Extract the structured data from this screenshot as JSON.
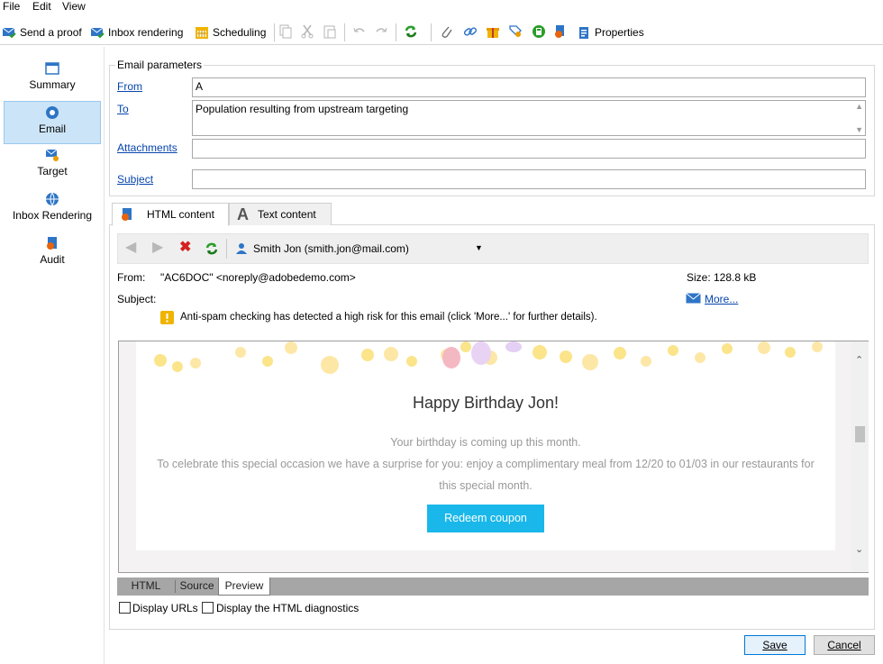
{
  "menu": {
    "items": [
      "File",
      "Edit",
      "View"
    ]
  },
  "toolbar": {
    "send_proof": "Send a proof",
    "inbox_rendering": "Inbox rendering",
    "scheduling": "Scheduling",
    "properties": "Properties"
  },
  "nav": {
    "items": [
      {
        "label": "Summary",
        "icon": "summary-icon"
      },
      {
        "label": "Email",
        "icon": "email-icon"
      },
      {
        "label": "Target",
        "icon": "target-icon"
      },
      {
        "label": "Inbox Rendering",
        "icon": "globe-icon"
      },
      {
        "label": "Audit",
        "icon": "audit-icon"
      }
    ],
    "active": "Email"
  },
  "params": {
    "legend": "Email parameters",
    "from_label": "From",
    "from_value": "A",
    "to_label": "To",
    "to_value": "Population resulting from upstream targeting",
    "attachments_label": "Attachments",
    "attachments_value": "",
    "subject_label": "Subject",
    "subject_value": ""
  },
  "content_tabs": {
    "html": "HTML content",
    "text": "Text content"
  },
  "preview": {
    "recipient": "Smith Jon (smith.jon@mail.com)",
    "from_label": "From:",
    "from_value": "\"AC6DOC\" <noreply@adobedemo.com>",
    "subject_label": "Subject:",
    "size_label": "Size:",
    "size_value": "128.8 kB",
    "more_link": "More...",
    "warning": "Anti-spam checking has detected a high risk for this email (click 'More...' for further details)."
  },
  "email": {
    "heading": "Happy Birthday Jon!",
    "line1": "Your birthday is coming up this month.",
    "line2": "To celebrate this special occasion we have a surprise for you: enjoy a complimentary meal from 12/20 to 01/03 in our restaurants for",
    "line3": "this special month.",
    "button": "Redeem coupon"
  },
  "bottom_tabs": {
    "html": "HTML",
    "source": "Source",
    "preview": "Preview",
    "selected": "Preview"
  },
  "options": {
    "display_urls": "Display URLs",
    "display_diagnostics": "Display the HTML diagnostics"
  },
  "footer": {
    "save": "Save",
    "cancel": "Cancel"
  },
  "colors": {
    "accent": "#1ab7ea",
    "link": "#0645ad",
    "nav_active": "#cce4f7"
  }
}
